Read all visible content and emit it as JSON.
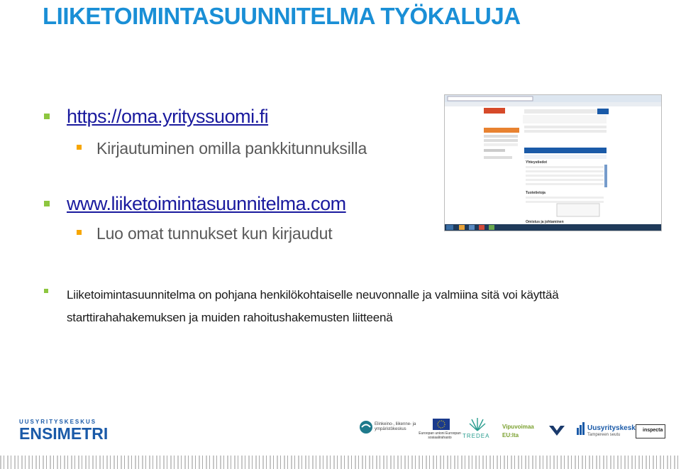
{
  "title": "LIIKETOIMINTASUUNNITELMA TYÖKALUJA",
  "bullets": [
    {
      "link": "https://oma.yrityssuomi.fi",
      "sub": "Kirjautuminen omilla pankkitunnuksilla"
    },
    {
      "link": "www.liiketoimintasuunnitelma.com",
      "sub": "Luo omat tunnukset kun kirjaudut"
    }
  ],
  "paragraph": "Liiketoimintasuunnitelma on pohjana henkilökohtaiselle neuvonnalle ja valmiina sitä voi käyttää starttirahahakemuksen ja muiden rahoitushakemusten liitteenä",
  "screenshot": {
    "sections": [
      "Yhteystiedot",
      "Tuotetietoja",
      "Omistus ja johtaminen"
    ]
  },
  "logos": {
    "ensimetri_top": "UUSYRITYSKESKUS",
    "ensimetri_main": "ENSIMETRI",
    "ely": "Elinkeino-, liikenne- ja ympäristökeskus",
    "eu": "Euroopan unioni Euroopan sosiaalirahasto",
    "tredea": "TREDEA",
    "vipuvoimaa": "Vipuvoimaa EU:lta",
    "uusyrityskeskus": "Uusyrityskeskus",
    "uusyrityskeskus_sub": "Tampereen seutu",
    "inspecta": "inspecta"
  },
  "colors": {
    "title": "#1a8fd6",
    "link": "#1a1a9e",
    "bullet_green": "#8dc63f",
    "bullet_orange": "#f7a600"
  }
}
